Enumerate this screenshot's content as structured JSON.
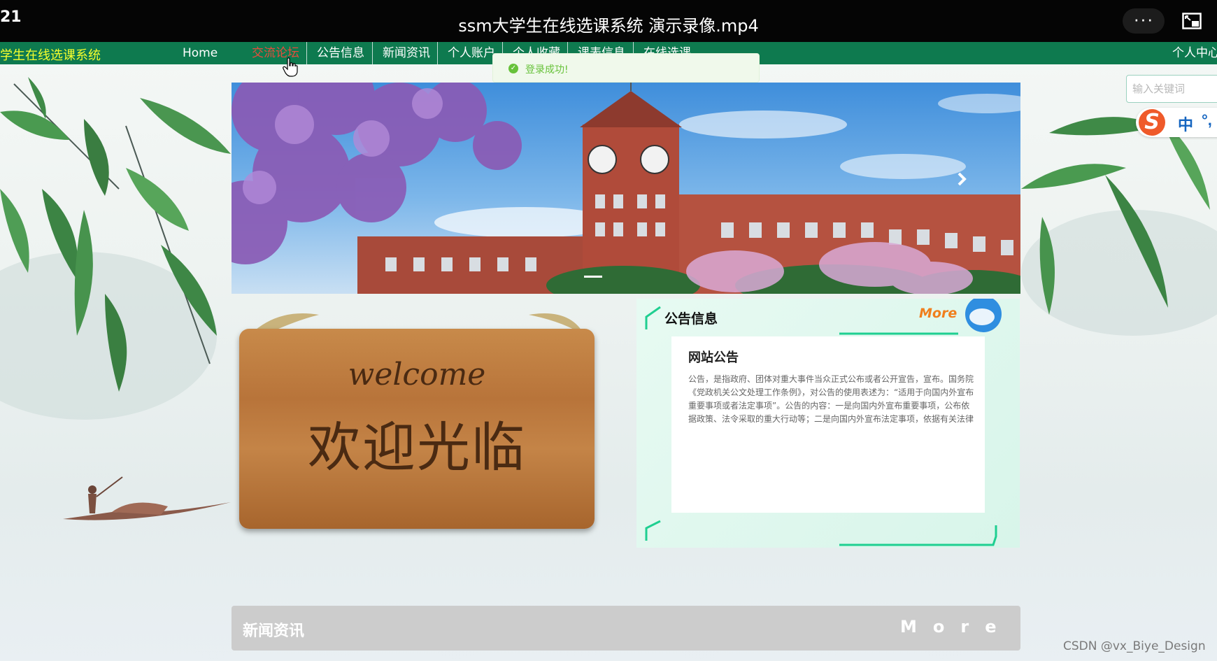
{
  "player": {
    "time": "21",
    "title": "ssm大学生在线选课系统 演示录像.mp4",
    "more_label": "···"
  },
  "site": {
    "logo": "学生在线选课系统",
    "nav": [
      {
        "label": "Home"
      },
      {
        "label": "交流论坛",
        "active": true
      },
      {
        "label": "公告信息"
      },
      {
        "label": "新闻资讯"
      },
      {
        "label": "个人账户"
      },
      {
        "label": "个人收藏"
      },
      {
        "label": "课表信息"
      },
      {
        "label": "在线选课"
      }
    ],
    "user_center": "个人中心"
  },
  "toast": {
    "text": "登录成功!",
    "icon": "check-circle-icon"
  },
  "search": {
    "placeholder": "输入关键词"
  },
  "ime": {
    "logo": "S",
    "mode": "中",
    "punct": "°,"
  },
  "welcome": {
    "script": "welcome",
    "text": "欢迎光临"
  },
  "notice": {
    "title": "公告信息",
    "more": "More",
    "card_title": "网站公告",
    "card_body": "公告，是指政府、团体对重大事件当众正式公布或者公开宣告，宣布。国务院《党政机关公文处理工作条例》，对公告的使用表述为：“适用于向国内外宣布重要事项或者法定事项”。公告的内容：一是向国内外宣布重要事项，公布依据政策、法令采取的重大行动等；二是向国内外宣布法定事项，依据有关法律规定告知国内外的有关重要规定和重大行动等。"
  },
  "news": {
    "title": "新闻资讯",
    "more": "More"
  },
  "watermark": "CSDN @vx_Biye_Design",
  "colors": {
    "nav_bg": "#0e7a4f",
    "logo": "#f6ff2d",
    "active_nav": "#e74c3c",
    "more_orange": "#f07f1d",
    "toast_green": "#67c23a"
  }
}
